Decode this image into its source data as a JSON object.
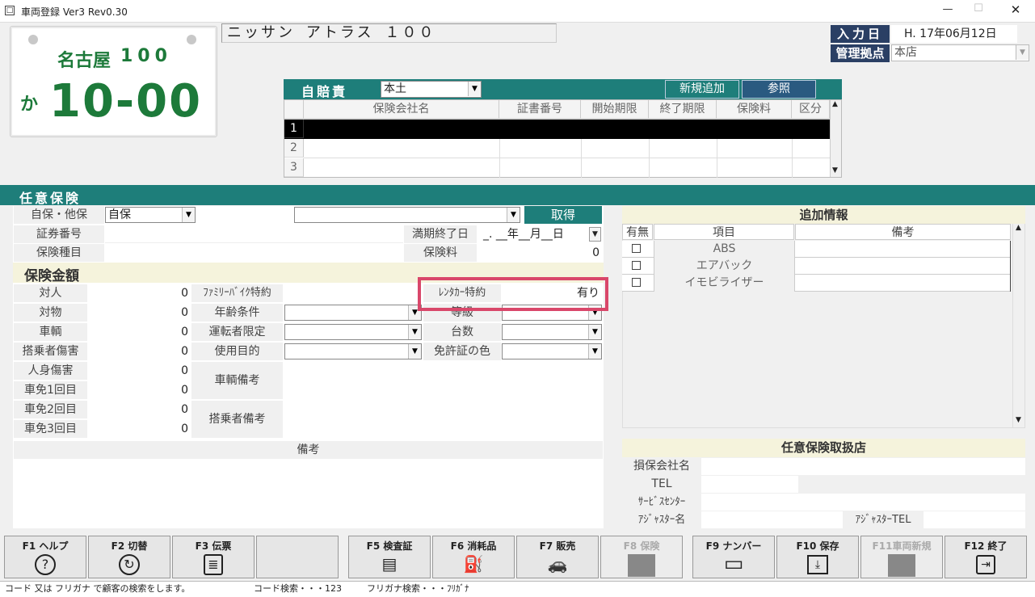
{
  "window": {
    "title": "車両登録 Ver3 Rev0.30",
    "minimize": "—",
    "maximize": "☐",
    "close": "✕"
  },
  "plate": {
    "region": "名古屋",
    "class_no": "100",
    "kana": "か",
    "number": "10-00"
  },
  "vehicle_name": "ニッサン アトラス １００",
  "input_date": {
    "label": "入力日",
    "value": "H. 17年06月12日"
  },
  "base": {
    "label": "管理拠点",
    "value": "本店"
  },
  "jibaiseki": {
    "label": "自賠責",
    "region": "本土",
    "new_button": "新規追加",
    "ref_button": "参照",
    "columns": [
      "保険会社名",
      "証書番号",
      "開始期限",
      "終了期限",
      "保険料",
      "区分"
    ],
    "row_numbers": [
      "1",
      "2",
      "3"
    ]
  },
  "nini": {
    "section": "任意保険",
    "self_other_label": "自保・他保",
    "self_other_value": "自保",
    "get_button": "取得",
    "cert_label": "証券番号",
    "expiry_label": "満期終了日",
    "expiry_value": "_. __年__月__日",
    "type_label": "保険種目",
    "premium_label": "保険料",
    "premium_value": "0"
  },
  "amounts": {
    "section": "保険金額",
    "rows": [
      {
        "label": "対人",
        "value": "0"
      },
      {
        "label": "対物",
        "value": "0"
      },
      {
        "label": "車輌",
        "value": "0"
      },
      {
        "label": "搭乗者傷害",
        "value": "0"
      },
      {
        "label": "人身傷害",
        "value": "0"
      },
      {
        "label": "車免1回目",
        "value": "0"
      },
      {
        "label": "車免2回目",
        "value": "0"
      },
      {
        "label": "車免3回目",
        "value": "0"
      }
    ],
    "family_bike": "ﾌｧﾐﾘｰﾊﾞｲｸ特約",
    "age": "年齢条件",
    "driver_limit": "運転者限定",
    "purpose": "使用目的",
    "rental_label": "ﾚﾝﾀｶｰ特約",
    "rental_value": "有り",
    "grade": "等級",
    "count": "台数",
    "license_color": "免許証の色",
    "vehicle_note": "車輌備考",
    "passenger_note": "搭乗者備考",
    "remarks": "備考"
  },
  "extra": {
    "title": "追加情報",
    "columns": [
      "有無",
      "項目",
      "備考"
    ],
    "items": [
      "ABS",
      "エアバック",
      "イモビライザー"
    ]
  },
  "agency": {
    "title": "任意保険取扱店",
    "company": "損保会社名",
    "tel": "TEL",
    "service": "ｻｰﾋﾞｽｾﾝﾀｰ",
    "adjuster": "ｱｼﾞｬｽﾀｰ名",
    "adjuster_tel": "ｱｼﾞｬｽﾀｰTEL"
  },
  "fkeys": [
    {
      "label": "F1 ヘルプ",
      "icon": "?",
      "enabled": true
    },
    {
      "label": "F2 切替",
      "icon": "↻",
      "enabled": true
    },
    {
      "label": "F3 伝票",
      "icon": "≣",
      "enabled": true
    },
    {
      "label": "F5 検査証",
      "icon": "▤",
      "enabled": true
    },
    {
      "label": "F6 消耗品",
      "icon": "⛽",
      "enabled": true
    },
    {
      "label": "F7 販売",
      "icon": "🚗",
      "enabled": true
    },
    {
      "label": "F8 保険",
      "icon": "",
      "enabled": false
    },
    {
      "label": "F9 ナンバー",
      "icon": "▭",
      "enabled": true
    },
    {
      "label": "F10 保存",
      "icon": "⤓",
      "enabled": true
    },
    {
      "label": "F11車両新規",
      "icon": "",
      "enabled": false
    },
    {
      "label": "F12 終了",
      "icon": "⇥",
      "enabled": true
    }
  ],
  "status": {
    "hint": "コード 又は フリガナ で顧客の検索をします。",
    "code_search": "コード検索・・・123",
    "kana_search": "フリガナ検索・・・ﾌﾘｶﾞﾅ"
  },
  "colors": {
    "teal": "#1e7e7a",
    "plate_green": "#1d7a3a",
    "highlight": "#d9476a"
  }
}
